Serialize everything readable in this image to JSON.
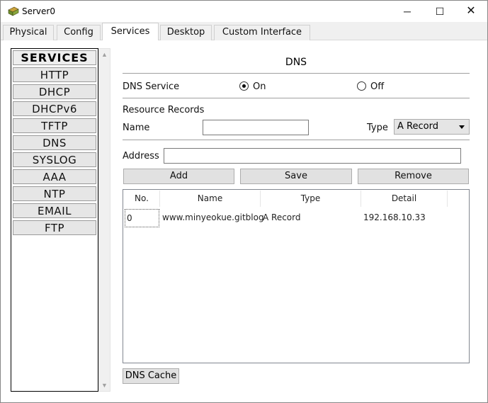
{
  "window": {
    "title": "Server0",
    "icon": "server-icon",
    "controls": {
      "minimize": "─",
      "maximize": "☐",
      "close": "✕"
    }
  },
  "tabs": [
    {
      "label": "Physical",
      "active": false
    },
    {
      "label": "Config",
      "active": false
    },
    {
      "label": "Services",
      "active": true
    },
    {
      "label": "Desktop",
      "active": false
    },
    {
      "label": "Custom Interface",
      "active": false
    }
  ],
  "services": {
    "header": "SERVICES",
    "items": [
      "HTTP",
      "DHCP",
      "DHCPv6",
      "TFTP",
      "DNS",
      "SYSLOG",
      "AAA",
      "NTP",
      "EMAIL",
      "FTP"
    ]
  },
  "dns": {
    "title": "DNS",
    "service_label": "DNS Service",
    "on_label": "On",
    "off_label": "Off",
    "service_state": "On",
    "resource_records_label": "Resource Records",
    "name_label": "Name",
    "name_value": "",
    "type_label": "Type",
    "type_value": "A Record",
    "address_label": "Address",
    "address_value": "",
    "buttons": {
      "add": "Add",
      "save": "Save",
      "remove": "Remove"
    },
    "table": {
      "columns": [
        "No.",
        "Name",
        "Type",
        "Detail"
      ],
      "rows": [
        {
          "no": "0",
          "name": "www.minyeokue.gitblog",
          "type": "A Record",
          "detail": "192.168.10.33"
        }
      ]
    },
    "cache_button": "DNS Cache"
  }
}
